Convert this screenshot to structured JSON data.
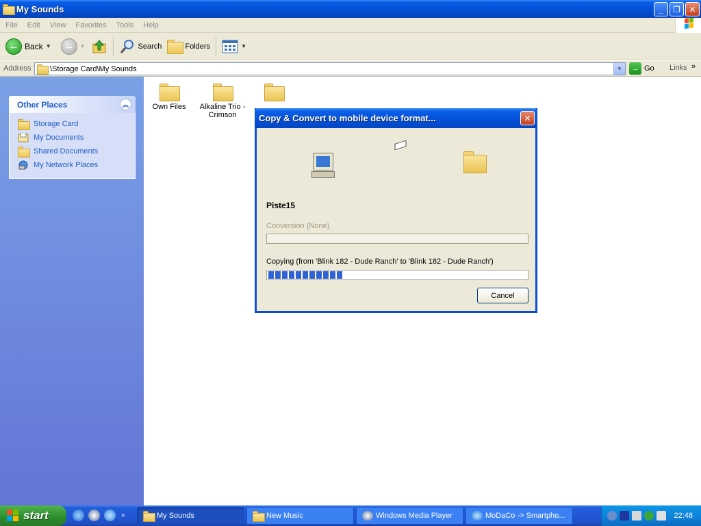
{
  "window": {
    "title": "My Sounds"
  },
  "menu": [
    "File",
    "Edit",
    "View",
    "Favorites",
    "Tools",
    "Help"
  ],
  "toolbar": {
    "back": "Back",
    "search": "Search",
    "folders": "Folders"
  },
  "address": {
    "label": "Address",
    "value": "\\Storage Card\\My Sounds",
    "go": "Go",
    "links": "Links",
    "chevron": "»"
  },
  "sidebar": {
    "title": "Other Places",
    "items": [
      {
        "label": "Storage Card",
        "icon": "folder-icon"
      },
      {
        "label": "My Documents",
        "icon": "my-documents-icon"
      },
      {
        "label": "Shared Documents",
        "icon": "folder-icon"
      },
      {
        "label": "My Network Places",
        "icon": "network-icon"
      }
    ]
  },
  "files": [
    {
      "label": "Own Files"
    },
    {
      "label": "Alkaline Trio - Crimson"
    },
    {
      "label": ""
    }
  ],
  "dialog": {
    "title": "Copy & Convert to mobile device format...",
    "file_name": "Piste15",
    "conversion_label": "Conversion (None)",
    "conversion_progress": 0,
    "copying_label": "Copying (from 'Blink 182 - Dude Ranch' to 'Blink 182 - Dude Ranch')",
    "copy_progress": 0.29,
    "cancel": "Cancel"
  },
  "taskbar": {
    "start": "start",
    "chevron": "»",
    "tasks": [
      {
        "label": "My Sounds",
        "active": true
      },
      {
        "label": "New Music",
        "active": false
      },
      {
        "label": "Windows Media Player",
        "active": false
      },
      {
        "label": "MoDaCo -> Smartpho...",
        "active": false
      }
    ],
    "clock": "22:48"
  },
  "colors": {
    "accent": "#0a5fe6",
    "sidebar": "#6d8de0",
    "progress": "#2f62d4"
  }
}
